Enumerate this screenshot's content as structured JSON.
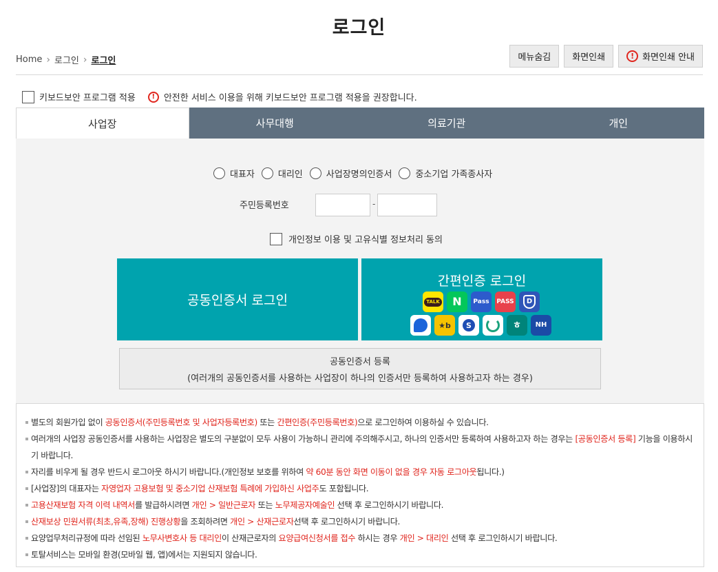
{
  "page_title": "로그인",
  "breadcrumb": {
    "home": "Home",
    "level1": "로그인",
    "current": "로그인"
  },
  "top_buttons": {
    "hide_menu": "메뉴숨김",
    "print": "화면인쇄",
    "print_guide": "화면인쇄 안내"
  },
  "keyboard_security": {
    "label": "키보드보안 프로그램 적용",
    "notice": "안전한 서비스 이용을 위해 키보드보안 프로그램 적용을 권장합니다."
  },
  "tabs": [
    {
      "label": "사업장",
      "active": true
    },
    {
      "label": "사무대행",
      "active": false
    },
    {
      "label": "의료기관",
      "active": false
    },
    {
      "label": "개인",
      "active": false
    }
  ],
  "login_form": {
    "user_types": [
      "대표자",
      "대리인",
      "사업장명의인증서",
      "중소기업 가족종사자"
    ],
    "rrn_label": "주민등록번호",
    "rrn_dash": "-",
    "consent_label": "개인정보 이용 및 고유식별 정보처리 동의",
    "cert_login": "공동인증서 로그인",
    "easy_login": "간편인증 로그인",
    "providers": {
      "kakao": "TALK",
      "naver": "N",
      "samsung_pass": "Pass",
      "pass": "PASS",
      "d": "D",
      "kb": "★b",
      "shinhan": "S",
      "hana": "ㅎ",
      "nh": "NH"
    },
    "cert_register_title": "공동인증서 등록",
    "cert_register_desc": "(여러개의 공동인증서를 사용하는 사업장이 하나의 인증서만 등록하여 사용하고자 하는 경우)"
  },
  "notices": {
    "n1": {
      "a": "별도의 회원가입 없이 ",
      "b": "공동인증서(주민등록번호 및 사업자등록번호)",
      "c": " 또는 ",
      "d": "간편인증(주민등록번호)",
      "e": "으로 로그인하여 이용하실 수 있습니다."
    },
    "n2": {
      "a": "여러개의 사업장 공동인증서를 사용하는 사업장은 별도의 구분없이 모두 사용이 가능하니 관리에 주의해주시고, 하나의 인증서만 등록하여 사용하고자 하는 경우는 ",
      "b": "[공동인증서 등록]",
      "c": " 기능을 이용하시기 바랍니다."
    },
    "n3": {
      "a": "자리를 비우게 될 경우 반드시 로그아웃 하시기 바랍니다.(개인정보 보호를 위하여 ",
      "b": "약 60분 동안 화면 이동이 없을 경우 자동 로그아웃",
      "c": "됩니다.)"
    },
    "n4": {
      "a": "[사업장]의 대표자는 ",
      "b": "자영업자 고용보험 및 중소기업 산재보험 특례에 가입하신 사업주",
      "c": "도 포함됩니다."
    },
    "n5": {
      "a": "고용산재보험 자격 이력 내역서",
      "b": "를 발급하시려면 ",
      "c": "개인 > 일반근로자",
      "d": " 또는 ",
      "e": "노무제공자예술인",
      "f": " 선택 후 로그인하시기 바랍니다."
    },
    "n6": {
      "a": "산재보상 민원서류(최초,유족,장해) 진행상황",
      "b": "을 조회하려면 ",
      "c": "개인 > 산재근로자",
      "d": "선택 후 로그인하시기 바랍니다."
    },
    "n7": {
      "a": "요양업무처리규정에 따라 선임된 ",
      "b": "노무사변호사 등 대리인",
      "c": "이 산재근로자의 ",
      "d": "요양급여신청서를 접수",
      "e": " 하시는 경우 ",
      "f": "개인 > 대리인",
      "g": " 선택 후 로그인하시기 바랍니다."
    },
    "n8": {
      "a": "토탈서비스는 모바일 환경(모바일 웹, 앱)에서는 지원되지 않습니다."
    }
  },
  "colors": {
    "tab_bar": "#5f7080",
    "login_button": "#00a3ae",
    "highlight": "#e0261e"
  }
}
